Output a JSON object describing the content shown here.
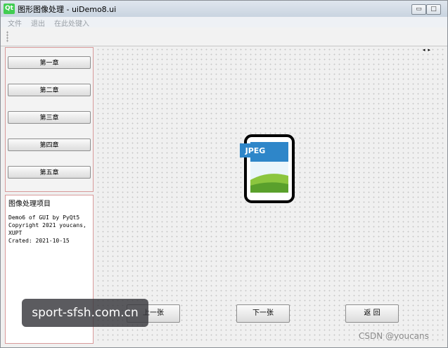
{
  "window": {
    "icon_text": "Qt",
    "title": "图形图像处理 - uiDemo8.ui",
    "minimize_glyph": "▭",
    "maximize_glyph": "□"
  },
  "menubar": {
    "items": [
      "文件",
      "退出",
      "在此处键入"
    ]
  },
  "chapters": [
    "第一章",
    "第二章",
    "第三章",
    "第四章",
    "第五章"
  ],
  "info": {
    "title": "图像处理项目",
    "lines": "Demo6 of GUI by PyQt5\nCopyright 2021 youcans, XUPT\nCrated: 2021-10-15"
  },
  "canvas": {
    "scroll_arrows": "◂▸",
    "image_badge": "JPEG",
    "image_icon": "jpeg-file-icon"
  },
  "buttons": {
    "prev": "上一张",
    "next": "下一张",
    "back": "返 回"
  },
  "overlays": {
    "watermark": "sport-sfsh.com.cn",
    "credit": "CSDN @youcans"
  },
  "colors": {
    "panel_border": "#d89a9a",
    "icon_blue": "#2e86c9",
    "icon_green": "#8cc63f"
  }
}
